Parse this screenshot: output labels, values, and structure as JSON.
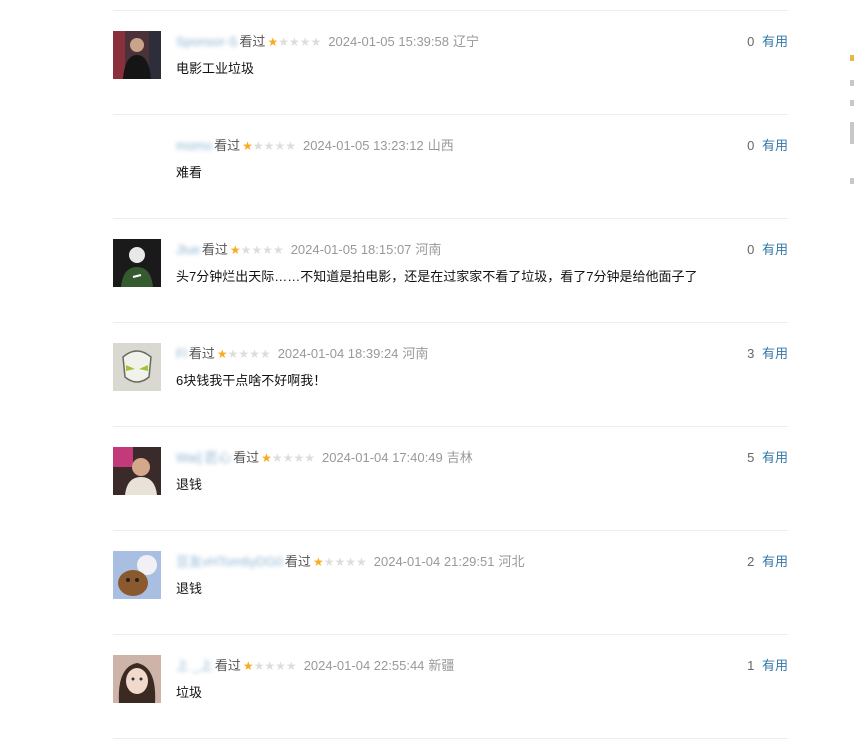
{
  "comments": [
    {
      "user": "Sponsor-S",
      "status": "看过",
      "rating": 1,
      "time": "2024-01-05 15:39:58",
      "location": "辽宁",
      "votes": "0",
      "vote_label": "有用",
      "text": "电影工业垃圾",
      "avatar_color": "#5a3a3f"
    },
    {
      "user": "momo",
      "status": "看过",
      "rating": 1,
      "time": "2024-01-05 13:23:12",
      "location": "山西",
      "votes": "0",
      "vote_label": "有用",
      "text": "难看",
      "avatar_color": "#ffffff"
    },
    {
      "user": "Jlue",
      "status": "看过",
      "rating": 1,
      "time": "2024-01-05 18:15:07",
      "location": "河南",
      "votes": "0",
      "vote_label": "有用",
      "text": "头7分钟烂出天际……不知道是拍电影，还是在过家家不看了垃圾，看了7分钟是给他面子了",
      "avatar_color": "#1c1c1c"
    },
    {
      "user": "Fl",
      "status": "看过",
      "rating": 1,
      "time": "2024-01-04 18:39:24",
      "location": "河南",
      "votes": "3",
      "vote_label": "有用",
      "text": "6块钱我干点啥不好啊我！",
      "avatar_color": "#d8d8d0"
    },
    {
      "user": "Wai] 匠心",
      "status": "看过",
      "rating": 1,
      "time": "2024-01-04 17:40:49",
      "location": "吉林",
      "votes": "5",
      "vote_label": "有用",
      "text": "退钱",
      "avatar_color": "#6d4a3a"
    },
    {
      "user": "豆友vHTom6yDG0",
      "status": "看过",
      "rating": 1,
      "time": "2024-01-04 21:29:51",
      "location": "河北",
      "votes": "2",
      "vote_label": "有用",
      "text": "退钱",
      "avatar_color": "#a7bde0"
    },
    {
      "user": "上  _上",
      "status": "看过",
      "rating": 1,
      "time": "2024-01-04 22:55:44",
      "location": "新疆",
      "votes": "1",
      "vote_label": "有用",
      "text": "垃圾",
      "avatar_color": "#c9a79b"
    }
  ],
  "icons": {
    "star_filled": "star-filled-icon",
    "star_empty": "star-empty-icon"
  }
}
